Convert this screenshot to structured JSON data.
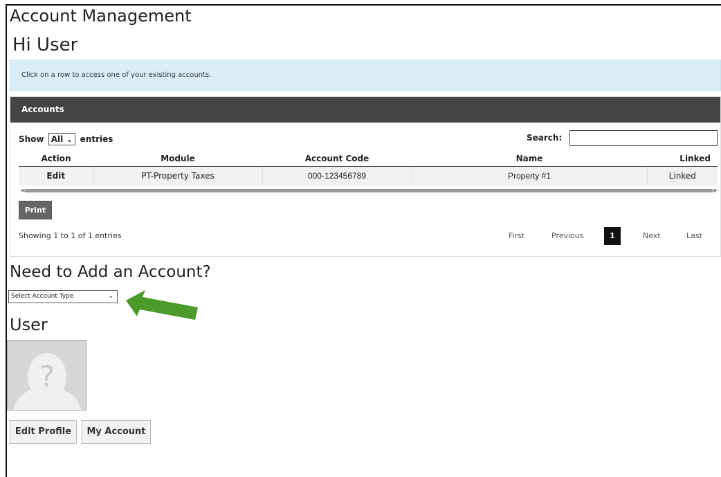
{
  "header": {
    "title": "Account Management",
    "greeting": "Hi User"
  },
  "info": {
    "text": "Click on a row to access one of your existing accounts."
  },
  "accounts": {
    "panel_title": "Accounts",
    "show_label": "Show",
    "show_value": "All",
    "entries_label": "entries",
    "search_label": "Search:",
    "columns": [
      "Action",
      "Module",
      "Account Code",
      "Name",
      "Linked"
    ],
    "rows": [
      {
        "action": "Edit",
        "module": "PT-Property Taxes",
        "code": "000-123456789",
        "name": "Property #1",
        "linked": "Linked"
      }
    ],
    "print_label": "Print",
    "showing_text": "Showing 1 to 1 of 1 entries",
    "pagination": {
      "first": "First",
      "previous": "Previous",
      "current": "1",
      "next": "Next",
      "last": "Last"
    }
  },
  "add_account": {
    "title": "Need to Add an Account?",
    "select_value": "Select Account Type",
    "arrow_color": "#4c9a2a"
  },
  "user": {
    "title": "User",
    "edit_profile": "Edit Profile",
    "my_account": "My Account"
  },
  "colors": {
    "panel_header": "#444444",
    "info_bg": "#d9edf7",
    "current_page": "#111111"
  }
}
